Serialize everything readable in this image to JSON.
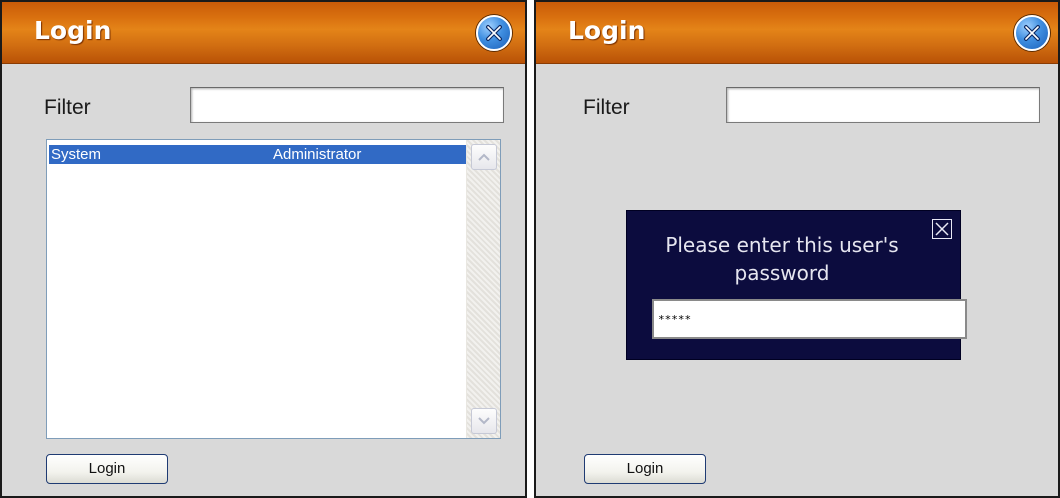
{
  "left_window": {
    "title": "Login",
    "filter": {
      "label": "Filter",
      "value": ""
    },
    "list": {
      "rows": [
        {
          "name": "System",
          "role": "Administrator",
          "selected": true
        }
      ]
    },
    "login_button": "Login"
  },
  "right_window": {
    "title": "Login",
    "filter": {
      "label": "Filter",
      "value": ""
    },
    "password_dialog": {
      "message": "Please enter this user's password",
      "password_value": "*****"
    },
    "login_button": "Login"
  },
  "colors": {
    "titlebar_orange": "#d9700f",
    "selection_blue": "#316ac5",
    "dialog_navy": "#0c0c3e",
    "window_gray": "#d9d9d9"
  },
  "icons": {
    "title_close": "close-circle-icon",
    "dialog_close": "close-box-icon",
    "scroll_up": "chevron-up-icon",
    "scroll_down": "chevron-down-icon"
  }
}
